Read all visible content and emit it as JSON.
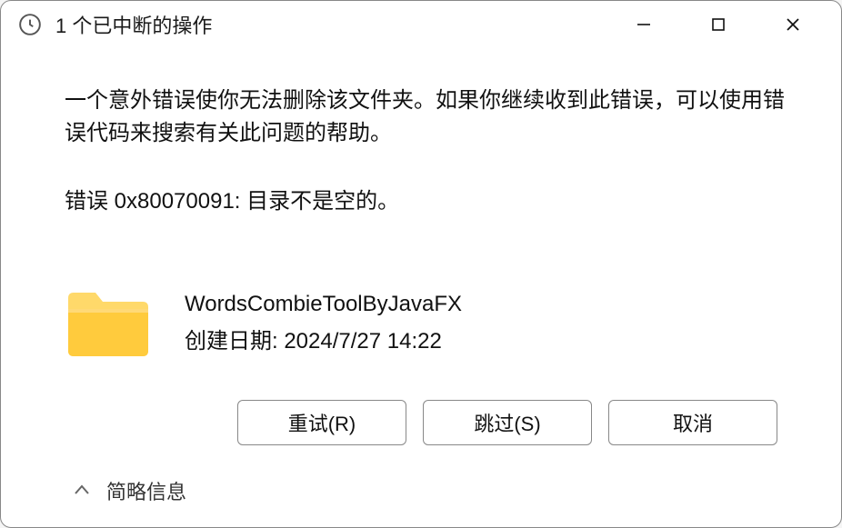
{
  "titlebar": {
    "title": "1 个已中断的操作"
  },
  "body": {
    "message": "一个意外错误使你无法删除该文件夹。如果你继续收到此错误，可以使用错误代码来搜索有关此问题的帮助。",
    "error_line": "错误 0x80070091: 目录不是空的。"
  },
  "item": {
    "name": "WordsCombieToolByJavaFX",
    "date_label": "创建日期: 2024/7/27 14:22"
  },
  "buttons": {
    "retry": "重试(R)",
    "skip": "跳过(S)",
    "cancel": "取消"
  },
  "details": {
    "label": "简略信息"
  }
}
